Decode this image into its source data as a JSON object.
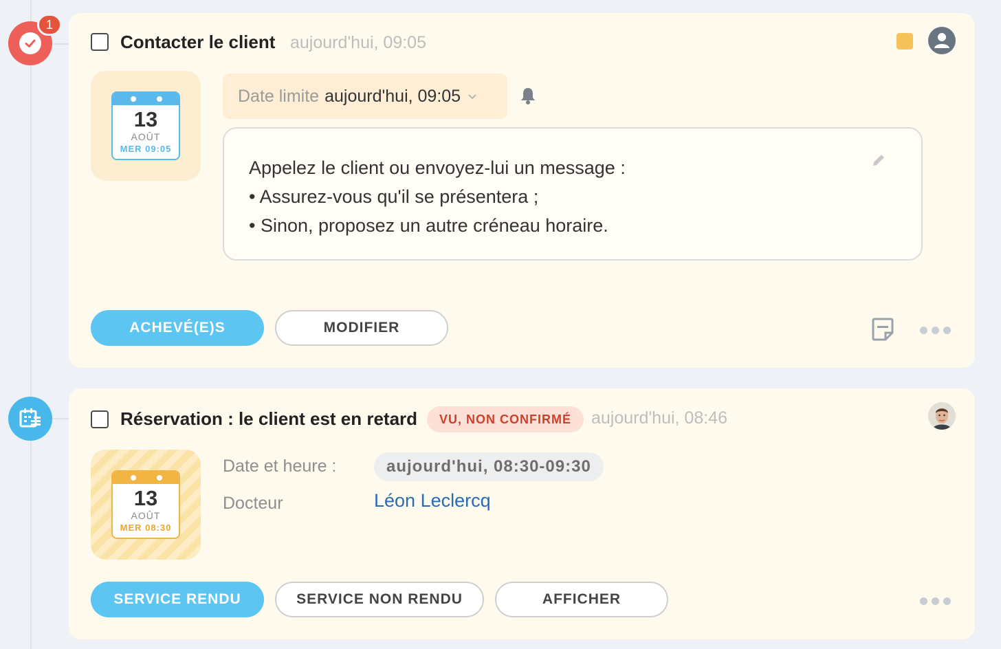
{
  "timeline": {
    "badge_count": "1",
    "icons": [
      "task-check-icon",
      "calendar-list-icon"
    ]
  },
  "task_card": {
    "title": "Contacter le client",
    "time": "aujourd'hui, 09:05",
    "calendar": {
      "day": "13",
      "month": "AOÛT",
      "sub": "MER 09:05"
    },
    "deadline": {
      "label": "Date limite",
      "value": "aujourd'hui, 09:05"
    },
    "note_lines": [
      "Appelez le client ou envoyez-lui un message :",
      "• Assurez-vous qu'il se présentera ;",
      "• Sinon, proposez un autre créneau horaire."
    ],
    "buttons": {
      "done": "ACHEVÉ(E)S",
      "edit": "MODIFIER"
    },
    "colors": {
      "flag": "#f5c35a",
      "accent": "#5cc5f2"
    }
  },
  "booking_card": {
    "title": "Réservation : le client est en retard",
    "status": "VU, NON CONFIRMÉ",
    "time": "aujourd'hui, 08:46",
    "calendar": {
      "day": "13",
      "month": "AOÛT",
      "sub": "MER 08:30"
    },
    "fields": {
      "datetime_label": "Date et heure :",
      "datetime_value": "aujourd'hui, 08:30-09:30",
      "doctor_label": "Docteur",
      "doctor_value": "Léon Leclercq"
    },
    "buttons": {
      "rendered": "SERVICE RENDU",
      "not_rendered": "SERVICE NON RENDU",
      "show": "AFFICHER"
    },
    "colors": {
      "status_bg": "#fde0d6",
      "status_text": "#cf3f2b",
      "link": "#2a6ab3"
    }
  }
}
